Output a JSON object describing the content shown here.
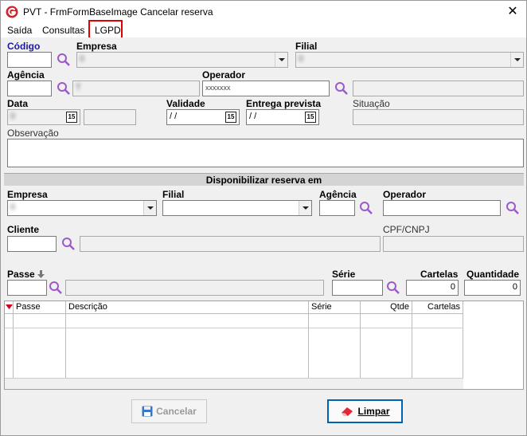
{
  "window": {
    "title": "PVT - FrmFormBaseImage Cancelar reserva",
    "close_glyph": "✕"
  },
  "menu": [
    {
      "label": "Saída"
    },
    {
      "label": "Consultas"
    },
    {
      "label": "LGPD"
    }
  ],
  "header": {
    "codigo_label": "Código",
    "empresa_label": "Empresa",
    "empresa_value": "0",
    "filial_label": "Filial",
    "filial_value": "0",
    "agencia_label": "Agência",
    "agencia_name": "T",
    "operador_label": "Operador",
    "operador_value": "xxxxxxx",
    "data_label": "Data",
    "data_value": "0",
    "validade_label": "Validade",
    "validade_value": " / /",
    "entrega_label": "Entrega prevista",
    "entrega_value": " / /",
    "situacao_label": "Situação",
    "observacao_label": "Observação",
    "calendar_glyph": "15"
  },
  "section_title": "Disponibilizar reserva em",
  "disponibilizar": {
    "empresa_label": "Empresa",
    "empresa_value": "0",
    "filial_label": "Filial",
    "agencia_label": "Agência",
    "operador_label": "Operador",
    "cliente_label": "Cliente",
    "cpf_label": "CPF/CNPJ",
    "passe_label": "Passe",
    "serie_label": "Série",
    "cartelas_label": "Cartelas",
    "cartelas_value": "0",
    "quantidade_label": "Quantidade",
    "quantidade_value": "0"
  },
  "grid": {
    "columns": [
      "Passe",
      "Descrição",
      "Série",
      "Qtde",
      "Cartelas"
    ]
  },
  "buttons": {
    "cancelar": "Cancelar",
    "limpar": "Limpar"
  },
  "colors": {
    "highlight": "#e00000",
    "search_icon": "#9b59c9",
    "label_blue": "#1a1a9c"
  }
}
